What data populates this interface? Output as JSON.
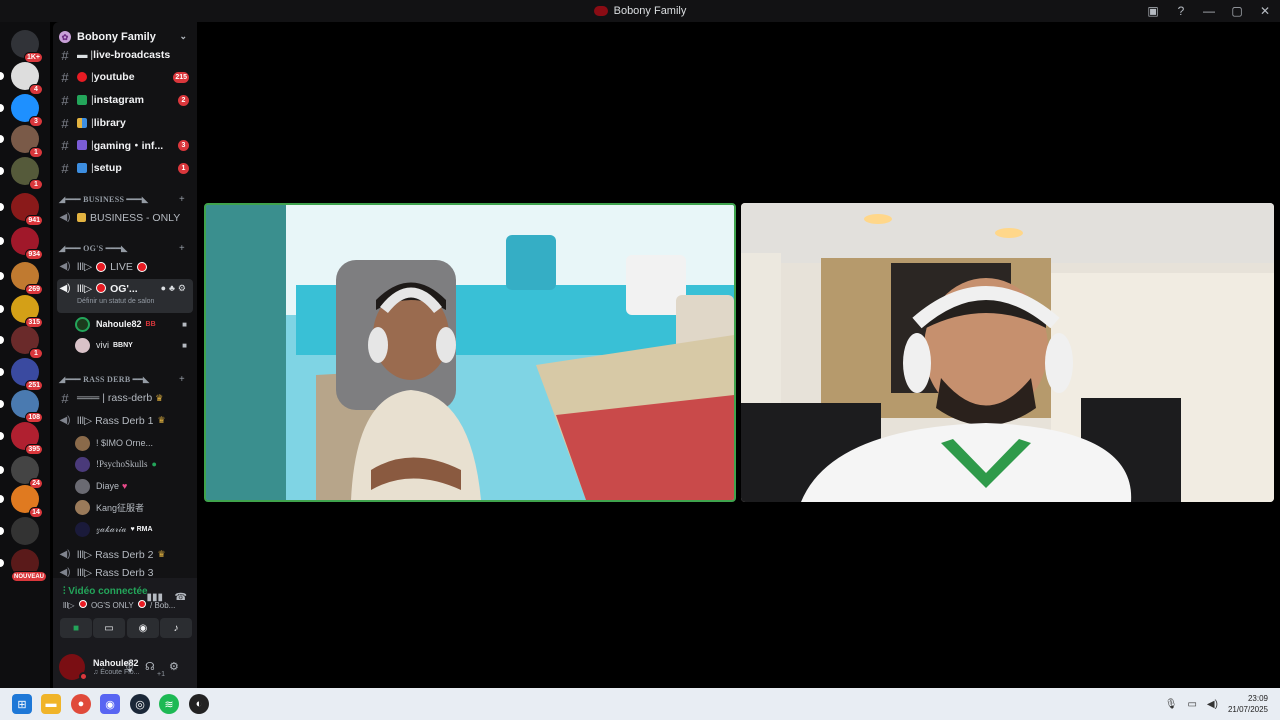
{
  "window": {
    "title": "Bobony Family",
    "titlebar_icons": [
      "inbox-icon",
      "help-icon",
      "minimize-icon",
      "maximize-icon",
      "close-icon"
    ],
    "titlebar_glyphs": [
      "▣",
      "?",
      "—",
      "▢",
      "✕"
    ]
  },
  "rail": {
    "servers": [
      {
        "name": "home",
        "badge": "1K+",
        "color": "#313338"
      },
      {
        "name": "server-2",
        "badge": "4",
        "color": "#dddddd"
      },
      {
        "name": "server-3",
        "badge": "3",
        "color": "#1e90ff"
      },
      {
        "name": "server-4",
        "badge": "1",
        "color": "#7a5a48"
      },
      {
        "name": "server-5",
        "badge": "1",
        "color": "#555a3a"
      },
      {
        "name": "server-6",
        "badge": "941",
        "color": "#8a1a1a"
      },
      {
        "name": "server-7",
        "badge": "934",
        "color": "#a0182a"
      },
      {
        "name": "server-8",
        "badge": "269",
        "color": "#c07a30"
      },
      {
        "name": "server-9",
        "badge": "315",
        "color": "#d4a017"
      },
      {
        "name": "server-10",
        "badge": "1",
        "color": "#6a2a2a"
      },
      {
        "name": "server-11",
        "badge": "251",
        "color": "#3a4aa0"
      },
      {
        "name": "server-12",
        "badge": "108",
        "color": "#4a7ab0"
      },
      {
        "name": "server-13",
        "badge": "395",
        "color": "#b02030"
      },
      {
        "name": "server-14",
        "badge": "24",
        "color": "#444444"
      },
      {
        "name": "server-15",
        "badge": "14",
        "color": "#e07a20"
      },
      {
        "name": "server-16",
        "badge": "",
        "color": "#333333"
      },
      {
        "name": "server-17",
        "badge": "NOUVEAU",
        "color": "#5a1a1a"
      }
    ]
  },
  "sidebar": {
    "server_name": "Bobony Family",
    "text_channels": [
      {
        "name": "live-broadcasts",
        "prefix": "▬ | ",
        "count": ""
      },
      {
        "name": "youtube",
        "prefix": "| ",
        "count": "215"
      },
      {
        "name": "instagram",
        "prefix": "| ",
        "count": "2"
      },
      {
        "name": "library",
        "prefix": "| ",
        "count": ""
      },
      {
        "name": "gaming・inf...",
        "prefix": "| ",
        "count": "3"
      },
      {
        "name": "setup",
        "prefix": "| ",
        "count": "1"
      }
    ],
    "categories": {
      "business": "◢━━━ BUSINESS ━━━◣",
      "ogs": "◢━━━ OG'S ━━━◣",
      "rassderb": "◢━━━ RASS DERB ━━◣"
    },
    "business_channel": "BUSINESS - ONLY",
    "og_live": "LIVE",
    "og_only": {
      "name": "OG'...",
      "status": "Définir un statut de salon"
    },
    "og_users": [
      {
        "name": "Nahoule82",
        "tag": "BB"
      },
      {
        "name": "vivi",
        "tag": "BBNY"
      }
    ],
    "rass_text": "═══ | rass-derb",
    "rass1": "Rass Derb 1",
    "rass1_users": [
      {
        "name": "! $IMO Orne..."
      },
      {
        "name": "!PsychoSkulls"
      },
      {
        "name": "Diaye"
      },
      {
        "name": "Kang征服者"
      },
      {
        "name": "𝓏𝒶𝓀𝒶𝓇𝒾𝒶",
        "tag": "RMA"
      }
    ],
    "rass2": "Rass Derb 2",
    "rass3": "Rass Derb 3"
  },
  "voice_panel": {
    "status": "Vidéo connectée",
    "channel_prefix": "lll▷",
    "channel": "OG'S ONLY",
    "channel_suffix": "/ Bob..."
  },
  "user": {
    "name": "Nahoule82",
    "activity": "Écoute Flo...",
    "extra": "+1"
  },
  "taskbar": {
    "time": "23:09",
    "date": "21/07/2025"
  }
}
